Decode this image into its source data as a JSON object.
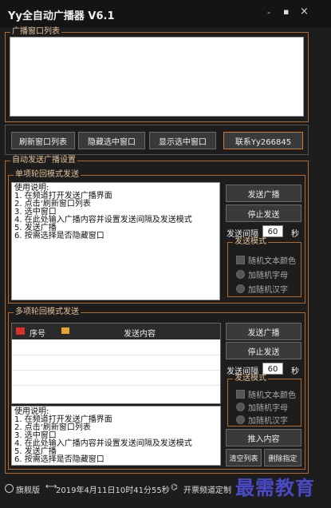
{
  "window": {
    "title": "Yy全自动广播器  V6.1",
    "minimize": "-",
    "maximize": "▪",
    "close": "×"
  },
  "broadcast_list": {
    "legend": "广播窗口列表"
  },
  "toolbar": {
    "refresh": "刷新窗口列表",
    "hide": "隐藏选中窗口",
    "show": "显示选中窗口",
    "qq": "联系Yy266845"
  },
  "auto_settings": {
    "legend": "自动发送广播设置"
  },
  "single": {
    "legend": "单项轮回模式发送",
    "instructions": "使用说明:\n1. 在频道打开发送广播界面\n2. 点击‘刷新窗口列表\n3. 选中窗口\n4. 在此处输入广播内容并设置发送间隔及发送模式\n5. 发送广播\n6. 按需选择是否隐藏窗口",
    "send": "发送广播",
    "stop": "停止发送",
    "interval_label": "发送间隔",
    "interval_value": "60",
    "interval_unit": "秒",
    "mode_legend": "发送模式",
    "opt_color": "随机文本颜色",
    "opt_letters": "加随机字母",
    "opt_hanzi": "加随机汉字"
  },
  "multi": {
    "legend": "多项轮回模式发送",
    "col_seq": "序号",
    "col_content": "发送内容",
    "instructions": "使用说明:\n1. 在频道打开发送广播界面\n2. 点击‘刷新窗口列表\n3. 选中窗口\n4. 在此处输入广播内容并设置发送间隔及发送模式\n5. 发送广播\n6. 按需选择是否隐藏窗口",
    "send": "发送广播",
    "stop": "停止发送",
    "interval_label": "发送间隔",
    "interval_value": "60",
    "interval_unit": "秒",
    "mode_legend": "发送模式",
    "opt_color": "随机文本颜色",
    "opt_letters": "加随机字母",
    "opt_hanzi": "加随机汉字",
    "add": "推入内容",
    "clear": "清空列表",
    "delete": "删除指定"
  },
  "status": {
    "edition": "旗舰版",
    "datetime": "2019年4月11日10时41分55秒",
    "channel": "开票频道定制"
  },
  "watermark": "最需教育"
}
